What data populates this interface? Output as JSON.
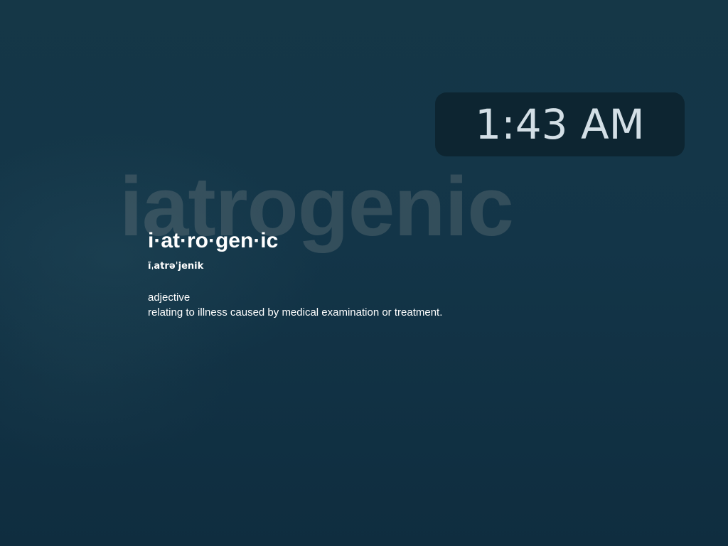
{
  "watermark": {
    "text": "iatrogenic"
  },
  "clock": {
    "time": "1:43 AM"
  },
  "entry": {
    "headword": "i·at·ro·gen·ic",
    "pronunciation": "īˌatrəˈjenik",
    "part_of_speech": "adjective",
    "definition": "relating to illness caused by medical examination or treatment."
  },
  "colors": {
    "background_top": "#153747",
    "background_bottom": "#0f2d3f",
    "clock_card": "#0c222c",
    "clock_text": "#d3dfe6",
    "text": "#ffffff"
  }
}
